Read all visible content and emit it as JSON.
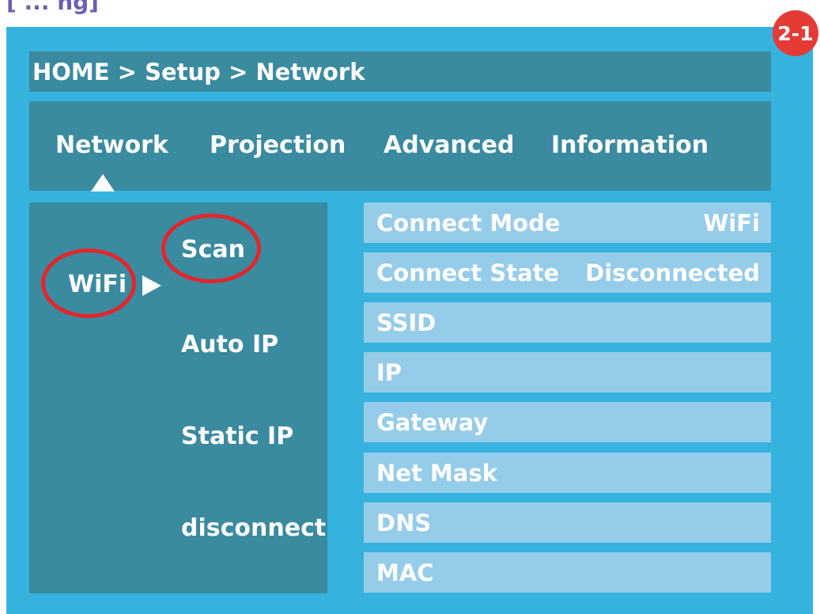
{
  "header_label": "[ ... ng]",
  "badge": "2-1",
  "breadcrumb": "HOME > Setup > Network",
  "tabs": [
    "Network",
    "Projection",
    "Advanced",
    "Information"
  ],
  "selected_tab": "Network",
  "menu": {
    "wifi": "WiFi",
    "scan": "Scan",
    "auto_ip": "Auto IP",
    "static_ip": "Static IP",
    "disconnect": "disconnect"
  },
  "info": [
    {
      "label": "Connect Mode",
      "value": "WiFi"
    },
    {
      "label": "Connect State",
      "value": "Disconnected"
    },
    {
      "label": "SSID",
      "value": ""
    },
    {
      "label": "IP",
      "value": ""
    },
    {
      "label": "Gateway",
      "value": ""
    },
    {
      "label": "Net Mask",
      "value": ""
    },
    {
      "label": "DNS",
      "value": ""
    },
    {
      "label": "MAC",
      "value": ""
    }
  ],
  "colors": {
    "frame": "#35b2dd",
    "panel": "#3a8aa0",
    "row": "#95cce9",
    "highlight": "#e3262b",
    "badge": "#e43b37"
  }
}
